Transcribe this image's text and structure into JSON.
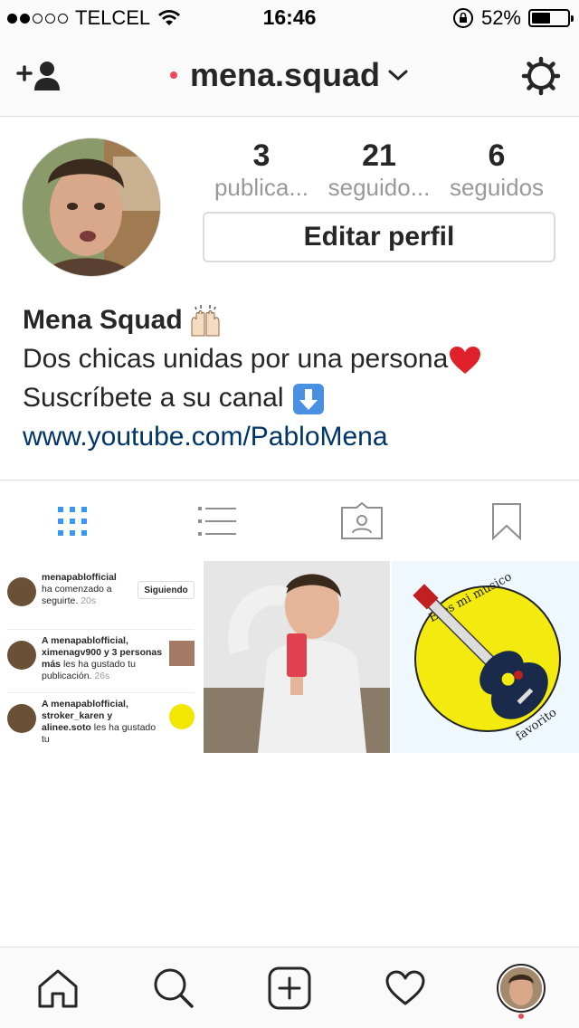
{
  "status_bar": {
    "carrier": "TELCEL",
    "time": "16:46",
    "battery_percent": "52%",
    "battery_level": 0.52
  },
  "nav": {
    "username": "mena.squad"
  },
  "profile": {
    "stats": [
      {
        "value": "3",
        "label": "publica..."
      },
      {
        "value": "21",
        "label": "seguido..."
      },
      {
        "value": "6",
        "label": "seguidos"
      }
    ],
    "edit_button": "Editar perfil",
    "name": "Mena Squad",
    "bio_line1": "Dos chicas unidas por una persona",
    "bio_line2": "Suscríbete a su canal",
    "link": "www.youtube.com/PabloMena"
  },
  "tabs": [
    {
      "icon": "grid-icon",
      "active": true
    },
    {
      "icon": "list-icon",
      "active": false
    },
    {
      "icon": "tagged-icon",
      "active": false
    },
    {
      "icon": "bookmark-icon",
      "active": false
    }
  ],
  "grid": {
    "post1": {
      "items": [
        {
          "user": "menapablofficial",
          "text": "ha comenzado a seguirte.",
          "time": "20s",
          "button": "Siguiendo"
        },
        {
          "user": "A menapablofficial, ximenagv900 y 3 personas más",
          "text": "les ha gustado tu publicación.",
          "time": "26s"
        },
        {
          "user": "A menapablofficial, stroker_karen y alinee.soto",
          "text": "les ha gustado tu"
        }
      ]
    },
    "post3": {
      "text_top": "Eres mi musico",
      "text_bottom": "favorito"
    }
  },
  "colors": {
    "accent_blue": "#3897f0",
    "link_blue": "#003569",
    "notification_red": "#ed4956"
  }
}
